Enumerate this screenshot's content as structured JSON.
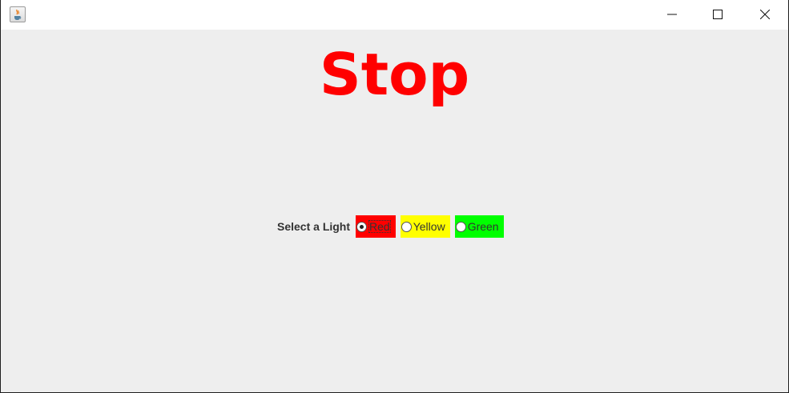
{
  "window": {
    "app_icon": "java-cup-icon",
    "controls": [
      "minimize-icon",
      "maximize-icon",
      "close-icon"
    ]
  },
  "main": {
    "status_text": "Stop",
    "status_color": "#ff0000"
  },
  "selector": {
    "label": "Select a Light",
    "options": [
      {
        "label": "Red",
        "bg_color": "#ff0000",
        "selected": true
      },
      {
        "label": "Yellow",
        "bg_color": "#ffff00",
        "selected": false
      },
      {
        "label": "Green",
        "bg_color": "#00ff00",
        "selected": false
      }
    ]
  }
}
